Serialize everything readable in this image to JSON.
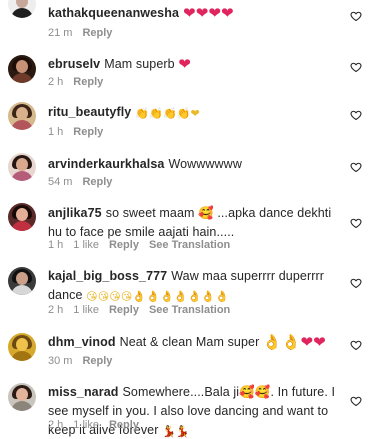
{
  "comments": [
    {
      "username": "kathakqueenanwesha",
      "text": "",
      "emoji": "❤❤❤❤",
      "time": "21 m",
      "likes": "",
      "reply": "Reply",
      "translation": ""
    },
    {
      "username": "ebruselv",
      "text": "Mam superb",
      "emoji": "❤",
      "time": "2 h",
      "likes": "",
      "reply": "Reply",
      "translation": ""
    },
    {
      "username": "ritu_beautyfly",
      "text": "",
      "emoji": "👏👏👏👏❤",
      "time": "1 h",
      "likes": "",
      "reply": "Reply",
      "translation": ""
    },
    {
      "username": "arvinderkaurkhalsa",
      "text": "Wowwwwww",
      "emoji": "",
      "time": "54 m",
      "likes": "",
      "reply": "Reply",
      "translation": ""
    },
    {
      "username": "anjlika75",
      "text": "so sweet maam 🥰 ...apka dance dekhti hu to face pe smile aajati hain.....",
      "emoji": "",
      "time": "1 h",
      "likes": "1 like",
      "reply": "Reply",
      "translation": "See Translation"
    },
    {
      "username": "kajal_big_boss_777",
      "text": "Waw maa superrrr duperrrr dance",
      "emoji": "😘😘😘😘👌👌👌👌👌👌👌",
      "time": "2 h",
      "likes": "1 like",
      "reply": "Reply",
      "translation": "See Translation"
    },
    {
      "username": "dhm_vinod",
      "text": "Neat & clean Mam super",
      "emoji": "👌👌❤❤",
      "time": "30 m",
      "likes": "",
      "reply": "Reply",
      "translation": ""
    },
    {
      "username": "miss_narad",
      "text": "Somewhere....Bala ji🥰🥰. In future. I see myself in you. I also love dancing and want to keep it alive forever",
      "emoji": "💃💃",
      "time": "2 h",
      "likes": "1 like",
      "reply": "Reply",
      "translation": ""
    }
  ],
  "colors": {
    "text": "#262626",
    "meta": "#8e8e8e",
    "heart": "#e0245e",
    "background": "#ffffff"
  },
  "icons": {
    "like": "heart-outline-icon",
    "avatar": "avatar"
  }
}
